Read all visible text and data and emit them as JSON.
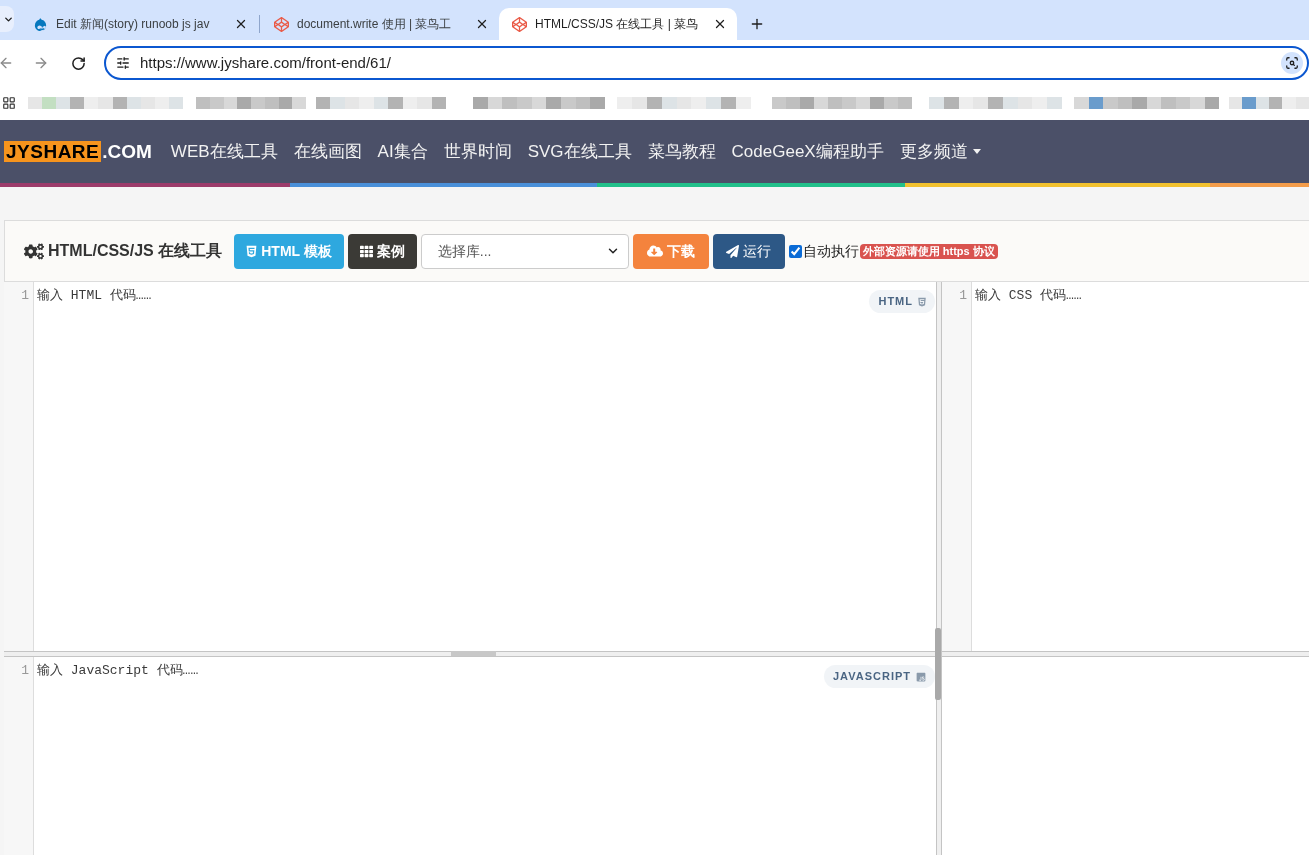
{
  "browser": {
    "tabs": [
      {
        "kind": "drop",
        "title": "Edit 新闻(story) runoob js jav",
        "selected": false
      },
      {
        "kind": "cube",
        "title": "document.write 使用 | 菜鸟工",
        "selected": false
      },
      {
        "kind": "cube",
        "title": "HTML/CSS/JS 在线工具 | 菜鸟",
        "selected": true
      }
    ],
    "address": "https://www.jyshare.com/front-end/61/"
  },
  "site_nav": {
    "logo": {
      "name": "JYSHARE",
      "suffix": ".COM"
    },
    "links": [
      {
        "label": "WEB在线工具",
        "dropdown": false
      },
      {
        "label": "在线画图",
        "dropdown": false
      },
      {
        "label": "AI集合",
        "dropdown": false
      },
      {
        "label": "世界时间",
        "dropdown": false
      },
      {
        "label": "SVG在线工具",
        "dropdown": false
      },
      {
        "label": "菜鸟教程",
        "dropdown": false
      },
      {
        "label": "CodeGeeX编程助手",
        "dropdown": false
      },
      {
        "label": "更多频道",
        "dropdown": true
      }
    ]
  },
  "toolbar": {
    "title": "HTML/CSS/JS 在线工具",
    "items": [
      {
        "kind": "template",
        "label": "HTML 模板"
      },
      {
        "kind": "examples",
        "label": "案例"
      },
      {
        "kind": "select",
        "placeholder": "选择库..."
      },
      {
        "kind": "download",
        "label": "下载"
      },
      {
        "kind": "run",
        "label": "运行"
      }
    ],
    "auto_run": {
      "label": "自动执行",
      "checked": true
    },
    "notice": "外部资源请使用 https 协议"
  },
  "editors": [
    {
      "kind": "html",
      "line_number": "1",
      "placeholder": "输入 HTML 代码……",
      "badge": "HTML"
    },
    {
      "kind": "css",
      "line_number": "1",
      "placeholder": "输入 CSS 代码……"
    },
    {
      "kind": "javascript",
      "line_number": "1",
      "placeholder": "输入 JavaScript 代码……",
      "badge": "JAVASCRIPT"
    }
  ]
}
